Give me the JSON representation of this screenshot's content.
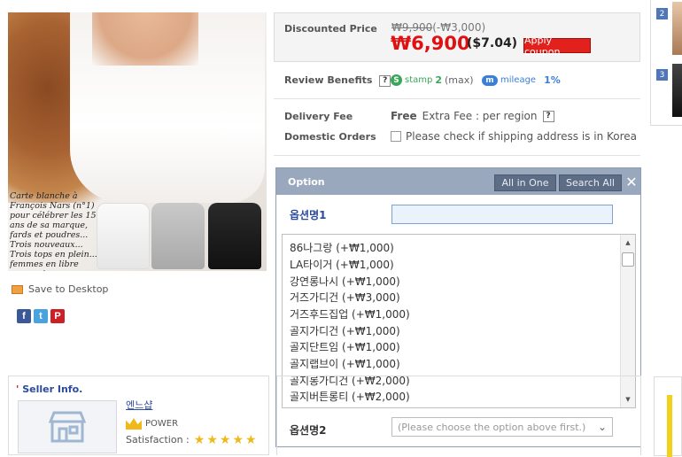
{
  "price": {
    "label": "Discounted Price",
    "original": "₩9,900",
    "discount": "(-₩3,000)",
    "sale": "₩6,900",
    "usd": "($7.04)",
    "coupon_label": "Apply coupon"
  },
  "review": {
    "label": "Review Benefits",
    "help": "?",
    "stamp_text": "stamp",
    "stamp_count": "2",
    "stamp_max": "(max)",
    "mileage_text": "mileage",
    "mileage_pct": "1%"
  },
  "delivery": {
    "label": "Delivery Fee",
    "value": "Free",
    "extra": "Extra Fee : per region",
    "help": "?"
  },
  "domestic": {
    "label": "Domestic Orders",
    "check_text": "Please check if shipping address is in Korea"
  },
  "option": {
    "title": "Option",
    "all_in_one": "All in One",
    "search_all": "Search All",
    "close": "✕",
    "opt1_label": "옵션명1",
    "opt1_value": "",
    "items": [
      "86나그랑 (+₩1,000)",
      "LA타이거 (+₩1,000)",
      "강연롱나시 (+₩1,000)",
      "거즈가디건 (+₩3,000)",
      "거즈후드집업 (+₩1,000)",
      "골지가디건 (+₩1,000)",
      "골지단트임 (+₩1,000)",
      "골지랩브이 (+₩1,000)",
      "골지롱가디건 (+₩2,000)",
      "골지버튼롱티 (+₩2,000)"
    ],
    "opt2_label": "옵션명2",
    "opt2_placeholder": "(Please choose the option above first.)"
  },
  "save": {
    "label": "Save to Desktop"
  },
  "social": {
    "facebook": "f",
    "twitter": "t",
    "pinterest": "P"
  },
  "magazine": {
    "text": "Carte blanche à François Nars (n°1) pour célébrer les 15 ans de sa marque, fards et poudres... Trois nouveaux... Trois tops en plein... femmes en libre expression... maquillages..."
  },
  "seller": {
    "title": "Seller Info.",
    "shop_name": "엔느샵",
    "power": "POWER",
    "satisfaction_label": "Satisfaction :",
    "rating": 5
  },
  "recommend": {
    "n2": "2",
    "n3": "3"
  },
  "colors": {
    "sale_red": "#e01010",
    "coupon_red": "#e3211c",
    "option_header": "#9aa8bd",
    "link_blue": "#2a4aa0"
  }
}
